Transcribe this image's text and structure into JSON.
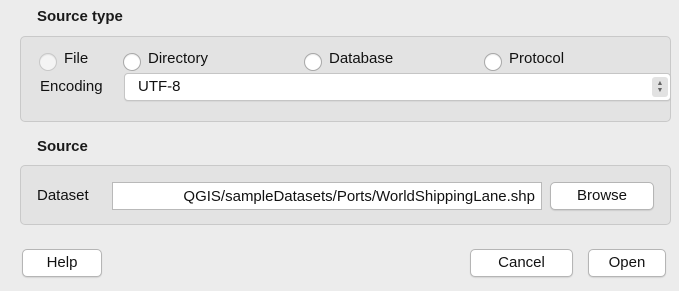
{
  "source_type": {
    "title": "Source type",
    "options": [
      {
        "label": "File",
        "selected": false
      },
      {
        "label": "Directory",
        "selected": false
      },
      {
        "label": "Database",
        "selected": false
      },
      {
        "label": "Protocol",
        "selected": false
      }
    ],
    "encoding_label": "Encoding",
    "encoding_value": "UTF-8"
  },
  "source": {
    "title": "Source",
    "dataset_label": "Dataset",
    "dataset_path": "QGIS/sampleDatasets/Ports/WorldShippingLane.shp",
    "browse_label": "Browse"
  },
  "buttons": {
    "help": "Help",
    "cancel": "Cancel",
    "open": "Open"
  }
}
